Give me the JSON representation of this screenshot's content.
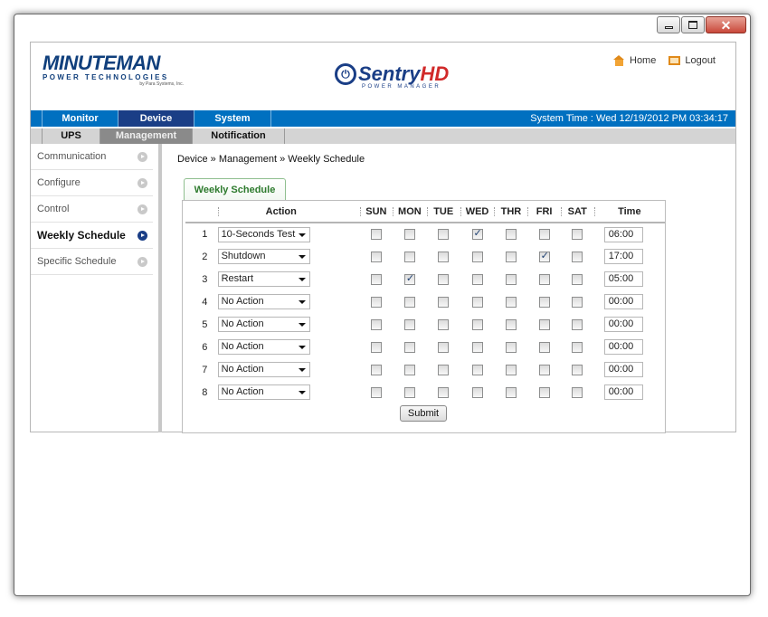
{
  "window": {
    "buttons": {
      "minimize": "minimize",
      "maximize": "maximize",
      "close": "close"
    }
  },
  "header": {
    "brand_name": "MINUTEMAN",
    "brand_sub": "POWER TECHNOLOGIES",
    "brand_sub2": "by Para Systems, Inc.",
    "product_name_1": "Sentry",
    "product_name_2": "HD",
    "product_sub": "POWER MANAGER",
    "links": {
      "home": "Home",
      "logout": "Logout"
    }
  },
  "nav": {
    "items": [
      "Monitor",
      "Device",
      "System"
    ],
    "active": "Device",
    "system_time": "System Time : Wed 12/19/2012 PM 03:34:17"
  },
  "subnav": {
    "items": [
      "UPS",
      "Management",
      "Notification"
    ],
    "active": "Management"
  },
  "sidebar": {
    "items": [
      "Communication",
      "Configure",
      "Control",
      "Weekly Schedule",
      "Specific Schedule"
    ],
    "active": "Weekly Schedule"
  },
  "breadcrumb": "Device » Management » Weekly Schedule",
  "tab": "Weekly Schedule",
  "schedule": {
    "headers": {
      "action": "Action",
      "time": "Time"
    },
    "days": [
      "SUN",
      "MON",
      "TUE",
      "WED",
      "THR",
      "FRI",
      "SAT"
    ],
    "rows": [
      {
        "num": "1",
        "action": "10-Seconds Test",
        "days": [
          false,
          false,
          false,
          true,
          false,
          false,
          false
        ],
        "time": "06:00"
      },
      {
        "num": "2",
        "action": "Shutdown",
        "days": [
          false,
          false,
          false,
          false,
          false,
          true,
          false
        ],
        "time": "17:00"
      },
      {
        "num": "3",
        "action": "Restart",
        "days": [
          false,
          true,
          false,
          false,
          false,
          false,
          false
        ],
        "time": "05:00"
      },
      {
        "num": "4",
        "action": "No Action",
        "days": [
          false,
          false,
          false,
          false,
          false,
          false,
          false
        ],
        "time": "00:00"
      },
      {
        "num": "5",
        "action": "No Action",
        "days": [
          false,
          false,
          false,
          false,
          false,
          false,
          false
        ],
        "time": "00:00"
      },
      {
        "num": "6",
        "action": "No Action",
        "days": [
          false,
          false,
          false,
          false,
          false,
          false,
          false
        ],
        "time": "00:00"
      },
      {
        "num": "7",
        "action": "No Action",
        "days": [
          false,
          false,
          false,
          false,
          false,
          false,
          false
        ],
        "time": "00:00"
      },
      {
        "num": "8",
        "action": "No Action",
        "days": [
          false,
          false,
          false,
          false,
          false,
          false,
          false
        ],
        "time": "00:00"
      }
    ],
    "submit_label": "Submit"
  },
  "colors": {
    "nav_blue": "#0070c0",
    "nav_active": "#1a3e86",
    "subnav_grey": "#d4d4d4",
    "tab_green": "#2d7a2d"
  }
}
